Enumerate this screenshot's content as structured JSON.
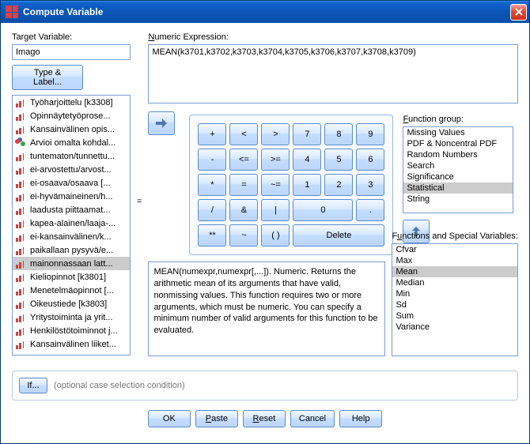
{
  "title": "Compute Variable",
  "target_label": "Target Variable:",
  "target_value": "Imago",
  "type_label_btn": "Type & Label...",
  "expr_label": "Numeric Expression:",
  "expr_value": "MEAN(k3701,k3702,k3703,k3704,k3705,k3706,k3707,k3708,k3709)",
  "variables": [
    {
      "label": "Työharjoittelu [k3308]",
      "icon": "bar"
    },
    {
      "label": "Opinnäytetyöprose...",
      "icon": "bar"
    },
    {
      "label": "Kansainvälinen opis...",
      "icon": "bar"
    },
    {
      "label": "Arvioi omalta kohdal...",
      "icon": "circles"
    },
    {
      "label": "tuntematon/tunnettu...",
      "icon": "bar"
    },
    {
      "label": "ei-arvostettu/arvost...",
      "icon": "bar"
    },
    {
      "label": "ei-osaava/osaava [...",
      "icon": "bar"
    },
    {
      "label": "ei-hyvämaineinen/h...",
      "icon": "bar"
    },
    {
      "label": "laadusta piittaamat...",
      "icon": "bar"
    },
    {
      "label": "kapea-alainen/laaja-...",
      "icon": "bar"
    },
    {
      "label": "ei-kansainvälinen/k...",
      "icon": "bar"
    },
    {
      "label": "paikallaan pysyvä/e...",
      "icon": "bar"
    },
    {
      "label": "mainonnassaan latt...",
      "icon": "bar",
      "selected": true
    },
    {
      "label": "Kieliopinnot [k3801]",
      "icon": "bar"
    },
    {
      "label": "Menetelmäopinnot [...",
      "icon": "bar"
    },
    {
      "label": "Oikeustiede [k3803]",
      "icon": "bar"
    },
    {
      "label": "Yritystoiminta ja yrit...",
      "icon": "bar"
    },
    {
      "label": "Henkilöstötoiminnot j...",
      "icon": "bar"
    },
    {
      "label": "Kansainvälinen liiket...",
      "icon": "bar"
    }
  ],
  "keypad": [
    [
      "+",
      "<",
      ">",
      "7",
      "8",
      "9"
    ],
    [
      "-",
      "<=",
      ">=",
      "4",
      "5",
      "6"
    ],
    [
      "*",
      "=",
      "~=",
      "1",
      "2",
      "3"
    ],
    [
      "/",
      "&",
      "|",
      "0",
      ".",
      ""
    ],
    [
      "**",
      "~",
      "( )",
      "Delete",
      "",
      ""
    ]
  ],
  "fn_group_label": "Function group:",
  "fn_groups": [
    "Missing Values",
    "PDF & Noncentral PDF",
    "Random Numbers",
    "Search",
    "Significance",
    "Statistical",
    "String"
  ],
  "fn_group_selected": "Statistical",
  "fn_list_label": "Functions and Special Variables:",
  "fn_list": [
    "Cfvar",
    "Max",
    "Mean",
    "Median",
    "Min",
    "Sd",
    "Sum",
    "Variance"
  ],
  "fn_list_selected": "Mean",
  "description": "MEAN(numexpr,numexpr[,...]). Numeric. Returns the arithmetic mean of its arguments that have valid, nonmissing values. This function requires two or more arguments, which must be numeric. You can specify a minimum number of valid arguments for this function to be evaluated.",
  "if_btn": "If...",
  "if_txt": "(optional case selection condition)",
  "footer": {
    "ok": "OK",
    "paste": "Paste",
    "reset": "Reset",
    "cancel": "Cancel",
    "help": "Help"
  }
}
